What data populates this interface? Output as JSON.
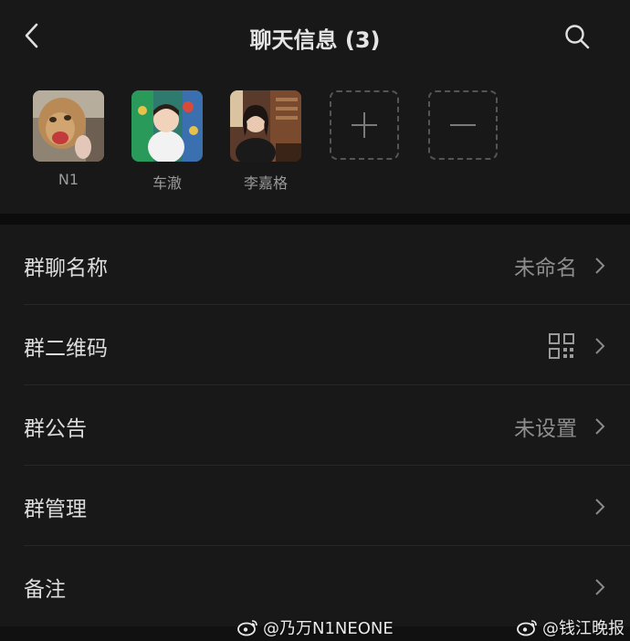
{
  "header": {
    "title": "聊天信息 (3)"
  },
  "members": [
    {
      "name": "N1"
    },
    {
      "name": "车澈"
    },
    {
      "name": "李嘉格"
    }
  ],
  "actions": {
    "add_icon": "plus-icon",
    "remove_icon": "minus-icon"
  },
  "settings": {
    "items": [
      {
        "label": "群聊名称",
        "value": "未命名"
      },
      {
        "label": "群二维码",
        "value": ""
      },
      {
        "label": "群公告",
        "value": "未设置"
      },
      {
        "label": "群管理",
        "value": ""
      },
      {
        "label": "备注",
        "value": ""
      }
    ]
  },
  "watermarks": {
    "left": "@乃万N1NEONE",
    "right": "@钱江晚报"
  }
}
